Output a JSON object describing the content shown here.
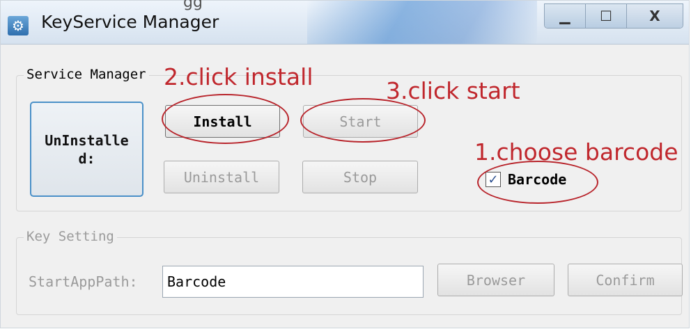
{
  "window": {
    "title": "KeyService Manager",
    "top_crop_text": "gg",
    "caption_buttons": {
      "minimize": "▁",
      "maximize": "☐",
      "close": "X"
    }
  },
  "service_manager": {
    "group_label": "Service Manager",
    "status_text": "UnInstalled:",
    "install_label": "Install",
    "start_label": "Start",
    "uninstall_label": "Uninstall",
    "stop_label": "Stop",
    "barcode_label": "Barcode",
    "barcode_checked": true,
    "check_glyph": "✓"
  },
  "key_setting": {
    "group_label": "Key Setting",
    "path_label": "StartAppPath:",
    "path_value": "Barcode",
    "browser_label": "Browser",
    "confirm_label": "Confirm"
  },
  "annotations": {
    "step1": "1.choose barcode",
    "step2": "2.click install",
    "step3": "3.click start",
    "color": "#c0272d"
  },
  "colors": {
    "window_bg": "#f0f0f0",
    "status_border": "#4a90c8",
    "disabled_text": "#9a9a9a"
  }
}
